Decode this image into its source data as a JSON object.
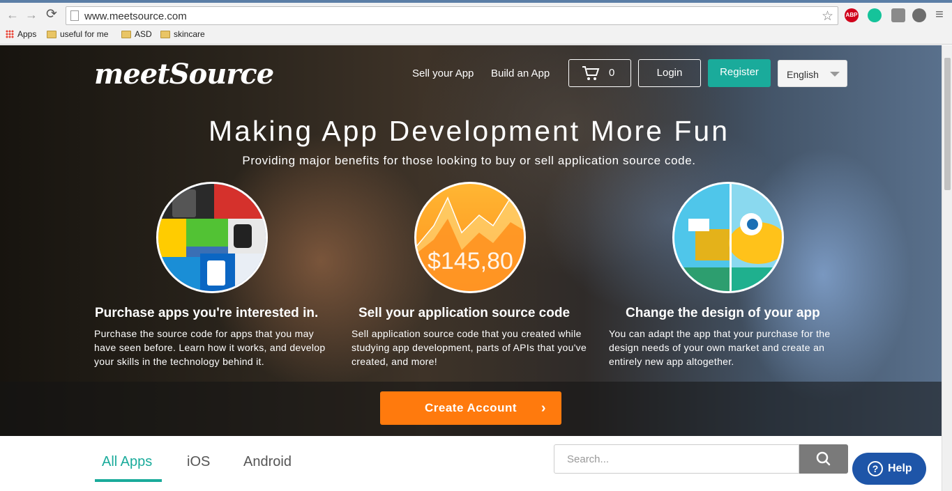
{
  "browser": {
    "url": "www.meetsource.com",
    "bookmarks": [
      "Apps",
      "useful for me",
      "ASD",
      "skincare"
    ],
    "extensions": [
      {
        "name": "adblock-plus-icon",
        "label": "ABP",
        "color": "#d0021b"
      },
      {
        "name": "grammarly-icon",
        "label": "",
        "color": "#15c39a"
      },
      {
        "name": "extension-puzzle-icon",
        "label": "",
        "color": "#8a8a8a"
      },
      {
        "name": "globe-icon",
        "label": "",
        "color": "#6d6d6d"
      }
    ]
  },
  "header": {
    "logo": "meetSource",
    "nav": {
      "sell": "Sell your App",
      "build": "Build an App"
    },
    "cart_count": "0",
    "login": "Login",
    "register": "Register",
    "language": "English"
  },
  "hero": {
    "headline": "Making App Development More Fun",
    "subline": "Providing major benefits for those looking to buy or sell application source code.",
    "chart_amount": "$145,80",
    "features": [
      {
        "title": "Purchase apps you're interested in.",
        "body": "Purchase the source code for apps that you may have seen before. Learn how it works, and develop your skills in the technology behind it."
      },
      {
        "title": "Sell your application source code",
        "body": "Sell application source code that you created while studying app development, parts of APIs that you've created, and more!"
      },
      {
        "title": "Change the design of your app",
        "body": "You can adapt the app that your purchase for the design needs of your own market and create an entirely new app altogether."
      }
    ],
    "cta": "Create Account"
  },
  "catalog": {
    "tabs": [
      "All Apps",
      "iOS",
      "Android"
    ],
    "active_tab": "All Apps",
    "search_placeholder": "Search..."
  },
  "help": {
    "label": "Help"
  },
  "colors": {
    "accent": "#1aab9b",
    "cta": "#ff7a0d",
    "help": "#1e55a8"
  }
}
